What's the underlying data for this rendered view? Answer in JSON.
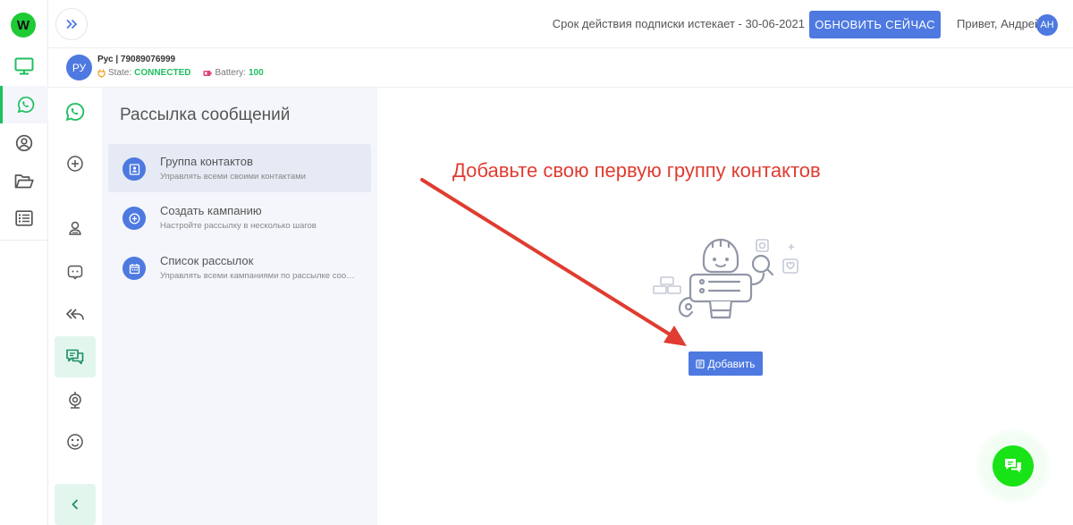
{
  "brand": {
    "logo_letter": "W",
    "accent": "#1fbf5f",
    "primary": "#4d79e0",
    "annotation_color": "#e03c31"
  },
  "rail": {
    "items": [
      {
        "icon": "monitor-icon"
      },
      {
        "icon": "whatsapp-icon",
        "active": true
      },
      {
        "icon": "user-circle-icon"
      },
      {
        "icon": "folder-open-icon"
      },
      {
        "icon": "list-icon"
      }
    ]
  },
  "header": {
    "subscription_text": "Срок действия подписки истекает - 30-06-2021",
    "upgrade_label": "ОБНОВИТЬ СЕЙЧАС",
    "greeting": "Привет, Андрей",
    "avatar_initials": "АН"
  },
  "device": {
    "avatar_initials": "РУ",
    "name": "Рус | 79089076999",
    "state_label": "State:",
    "state_value": "CONNECTED",
    "battery_label": "Battery:",
    "battery_value": "100"
  },
  "rail2": {
    "items": [
      {
        "icon": "whatsapp-icon"
      },
      {
        "icon": "plus-circle-icon"
      },
      {
        "icon": "contact-icon"
      },
      {
        "icon": "chat-square-icon"
      },
      {
        "icon": "reply-all-icon"
      },
      {
        "icon": "messages-icon",
        "active": true
      },
      {
        "icon": "webcam-icon"
      },
      {
        "icon": "smile-icon"
      }
    ],
    "collapse_icon": "chevron-left-icon"
  },
  "menu": {
    "title": "Рассылка сообщений",
    "items": [
      {
        "title": "Группа контактов",
        "subtitle": "Управлять всеми своими контактами",
        "icon": "contact-book-icon",
        "active": true
      },
      {
        "title": "Создать кампанию",
        "subtitle": "Настройте рассылку в несколько шагов",
        "icon": "plus-icon"
      },
      {
        "title": "Список рассылок",
        "subtitle": "Управлять всеми кампаниями по рассылке сооб...",
        "icon": "calendar-icon"
      }
    ]
  },
  "main": {
    "annotation": "Добавьте свою первую группу контактов",
    "add_label": "Добавить"
  }
}
